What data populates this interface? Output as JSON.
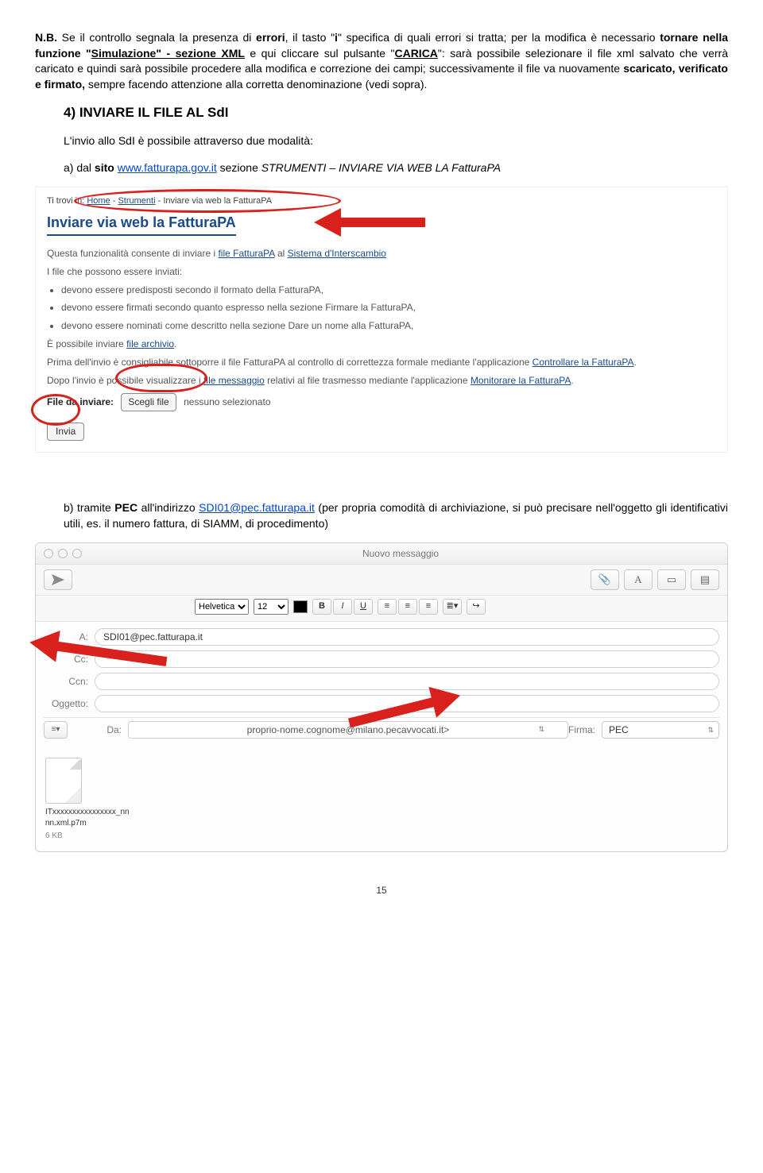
{
  "text": {
    "nb_prefix": "N.B.",
    "nb1_a": " Se il controllo segnala la presenza di ",
    "nb1_errori": "errori",
    "nb1_b": ", il tasto \"",
    "nb1_i": "i",
    "nb1_c": "\" specifica di quali errori si tratta; per la modifica è necessario ",
    "nb1_tornare": "tornare nella funzione \"",
    "nb1_sim_u": "Simulazione\" - sezione XML",
    "nb1_d": " e qui cliccare sul pulsante \"",
    "nb1_carica_u": "CARICA",
    "nb1_e": "\": sarà possibile selezionare il file xml salvato che verrà caricato e quindi sarà possibile procedere alla modifica e correzione dei campi; successivamente il file va nuovamente ",
    "nb1_svf": "scaricato, verificato e firmato,",
    "nb1_f": " sempre facendo attenzione alla corretta denominazione (vedi sopra).",
    "h4": "4) INVIARE IL FILE AL SdI",
    "p_invio": "L'invio allo SdI è possibile attraverso due modalità:",
    "a_pre": "a) dal ",
    "a_sito": "sito ",
    "a_link": "www.fatturapa.gov.it",
    "a_post": " sezione ",
    "a_it": "STRUMENTI – INVIARE VIA WEB LA FatturaPA",
    "b_pre": "b) tramite ",
    "b_pec": "PEC",
    "b_mid": " all'indirizzo ",
    "b_mail": "SDI01@pec.fatturapa.it",
    "b_post": " (per propria comodità di archiviazione, si può precisare nell'oggetto gli identificativi utili, es. il numero fattura, di SIAMM, di procedimento)",
    "page": "15"
  },
  "shot1": {
    "bc_prefix": "Ti trovi in: ",
    "bc_home": "Home",
    "bc_strumenti": "Strumenti",
    "bc_last": "Inviare via web la FatturaPA",
    "title": "Inviare via web la FatturaPA",
    "line1_a": "Questa funzionalità consente di inviare i ",
    "line1_u": "file FatturaPA",
    "line1_b": " al ",
    "line1_u2": "Sistema d'Interscambio",
    "line2": "I file che possono essere inviati:",
    "li1_a": "devono essere predisposti secondo il ",
    "li1_u": "formato della FatturaPA",
    "li1_b": ",",
    "li2_a": "devono essere firmati secondo quanto espresso nella sezione ",
    "li2_u": "Firmare la FatturaPA",
    "li2_b": ",",
    "li3_a": "devono essere nominati come descritto nella sezione ",
    "li3_u": "Dare un nome alla FatturaPA",
    "li3_b": ",",
    "line3_a": "È possibile inviare ",
    "line3_u": "file archivio",
    "line3_b": ".",
    "line4_a": "Prima dell'invio è consigliabile sottoporre il file FatturaPA al controllo di correttezza formale mediante l'applicazione ",
    "line4_u": "Controllare la FatturaPA",
    "line4_b": ".",
    "line5_a": "Dopo l'invio è possibile visualizzare i ",
    "line5_u": "file messaggio",
    "line5_b": " relativi al file trasmesso mediante l'applicazione ",
    "line5_u2": "Monitorare la FatturaPA",
    "line5_c": ".",
    "file_label": "File da inviare:",
    "choose": "Scegli file",
    "nofile": "nessuno selezionato",
    "submit": "Invia"
  },
  "mail": {
    "title": "Nuovo messaggio",
    "font": "Helvetica",
    "size": "12",
    "to_label": "A:",
    "to_value": "SDI01@pec.fatturapa.it",
    "cc_label": "Cc:",
    "ccn_label": "Ccn:",
    "subject_label": "Oggetto:",
    "da_label": "Da:",
    "da_value": "proprio-nome.cognome@milano.pecavvocati.it>",
    "firma_label": "Firma:",
    "firma_value": "PEC",
    "att_name": "ITxxxxxxxxxxxxxxxx_nnnn.xml.p7m",
    "att_size": "6 KB"
  }
}
